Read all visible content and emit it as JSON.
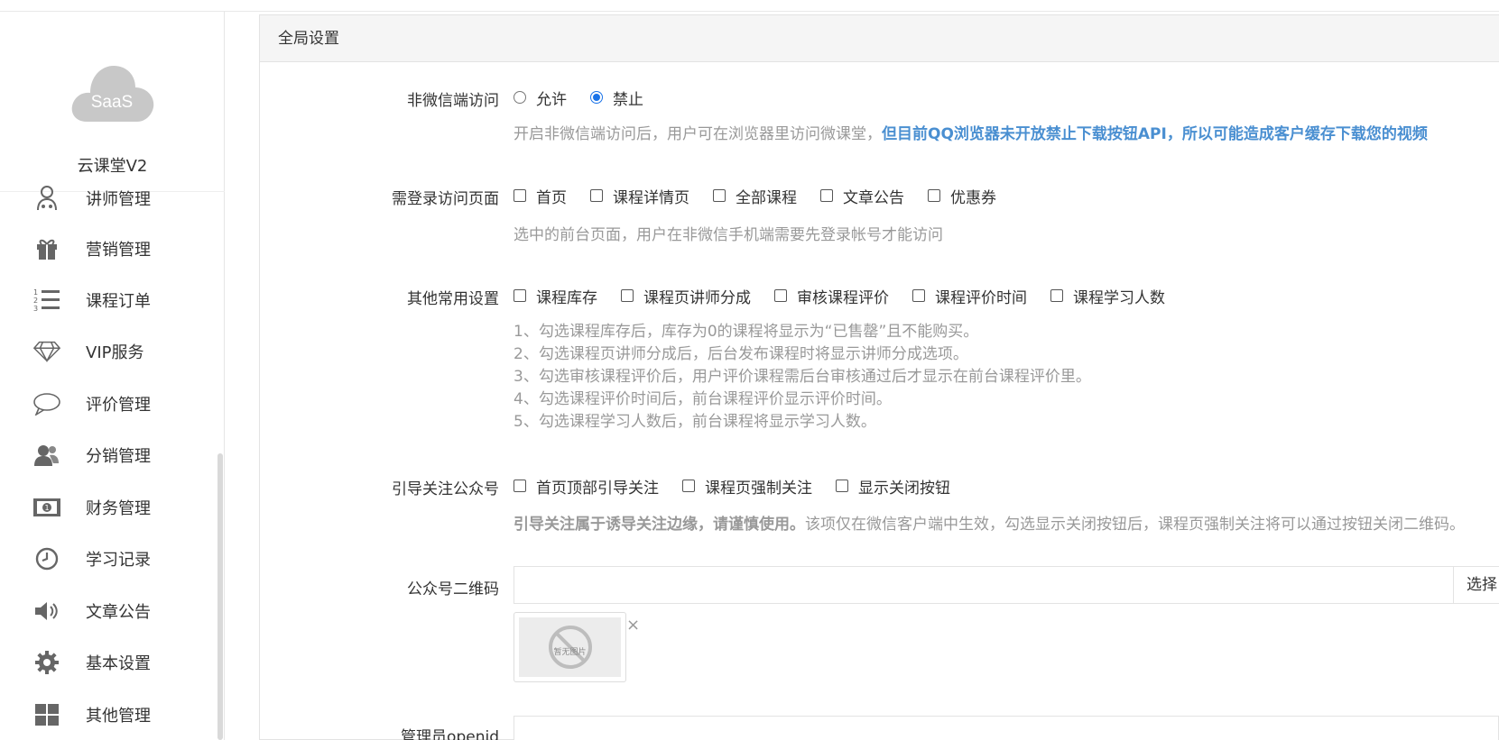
{
  "brand": {
    "logo_text": "SaaS",
    "name": "云课堂V2"
  },
  "sidebar": {
    "items": [
      {
        "label": "讲师管理",
        "icon": "teacher-icon"
      },
      {
        "label": "营销管理",
        "icon": "gift-icon"
      },
      {
        "label": "课程订单",
        "icon": "ordered-list-icon"
      },
      {
        "label": "VIP服务",
        "icon": "diamond-icon"
      },
      {
        "label": "评价管理",
        "icon": "comment-icon"
      },
      {
        "label": "分销管理",
        "icon": "users-icon"
      },
      {
        "label": "财务管理",
        "icon": "money-icon"
      },
      {
        "label": "学习记录",
        "icon": "clock-icon"
      },
      {
        "label": "文章公告",
        "icon": "speaker-icon"
      },
      {
        "label": "基本设置",
        "icon": "gear-icon"
      },
      {
        "label": "其他管理",
        "icon": "grid-icon"
      }
    ]
  },
  "panel": {
    "title": "全局设置"
  },
  "wechat_access": {
    "label": "非微信端访问",
    "options": [
      {
        "label": "允许",
        "checked": false
      },
      {
        "label": "禁止",
        "checked": true
      }
    ],
    "help_plain": "开启非微信端访问后，用户可在浏览器里访问微课堂，",
    "help_bold": "但目前QQ浏览器未开放禁止下载按钮API，所以可能造成客户缓存下载您的视频"
  },
  "login_pages": {
    "label": "需登录访问页面",
    "options": [
      {
        "label": "首页"
      },
      {
        "label": "课程详情页"
      },
      {
        "label": "全部课程"
      },
      {
        "label": "文章公告"
      },
      {
        "label": "优惠券"
      }
    ],
    "help": "选中的前台页面，用户在非微信手机端需要先登录帐号才能访问"
  },
  "common_settings": {
    "label": "其他常用设置",
    "options": [
      {
        "label": "课程库存"
      },
      {
        "label": "课程页讲师分成"
      },
      {
        "label": "审核课程评价"
      },
      {
        "label": "课程评价时间"
      },
      {
        "label": "课程学习人数"
      }
    ],
    "help_lines": [
      "1、勾选课程库存后，库存为0的课程将显示为“已售罄”且不能购买。",
      "2、勾选课程页讲师分成后，后台发布课程时将显示讲师分成选项。",
      "3、勾选审核课程评价后，用户评价课程需后台审核通过后才显示在前台课程评价里。",
      "4、勾选课程评价时间后，前台课程评价显示评价时间。",
      "5、勾选课程学习人数后，前台课程将显示学习人数。"
    ]
  },
  "follow_account": {
    "label": "引导关注公众号",
    "options": [
      {
        "label": "首页顶部引导关注"
      },
      {
        "label": "课程页强制关注"
      },
      {
        "label": "显示关闭按钮"
      }
    ],
    "help_bold": "引导关注属于诱导关注边缘，请谨慎使用。",
    "help_plain": "该项仅在微信客户端中生效，勾选显示关闭按钮后，课程页强制关注将可以通过按钮关闭二维码。"
  },
  "qrcode": {
    "label": "公众号二维码",
    "value": "",
    "button": "选择",
    "placeholder_text": "暂无图片",
    "remove": "×"
  },
  "admin_openid": {
    "label": "管理员openid",
    "value": ""
  },
  "colors": {
    "accent": "#1a73e8",
    "link": "#4a8fd1",
    "muted": "#999999"
  }
}
